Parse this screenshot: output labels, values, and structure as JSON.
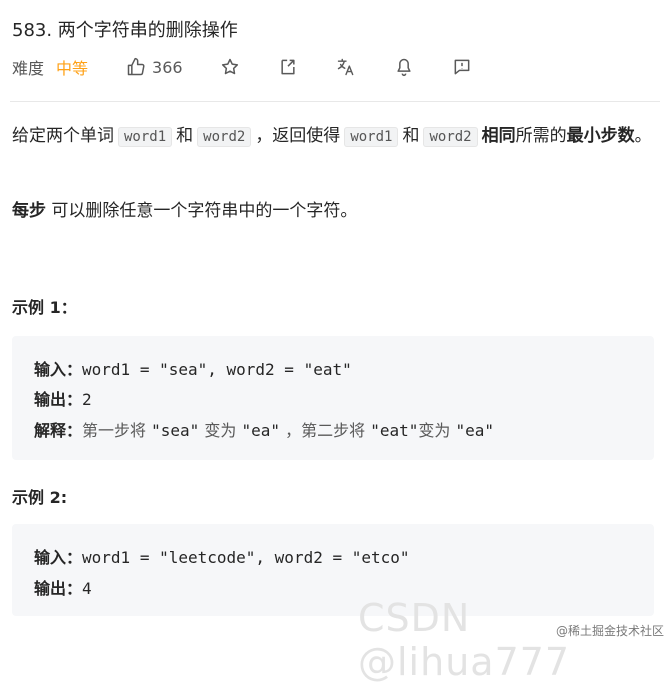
{
  "title": "583. 两个字符串的删除操作",
  "meta": {
    "difficulty_label": "难度",
    "difficulty": "中等",
    "likes": "366"
  },
  "description": {
    "s1": "给定两个单词",
    "code1": "word1",
    "s2": "和",
    "code2": "word2",
    "s3": "，返回使得",
    "code3": "word1",
    "s4": "和",
    "code4": "word2",
    "b1": "相同",
    "s5": "所需的",
    "b2": "最小步数",
    "s6": "。",
    "p2_bold": "每步",
    "p2_text": "可以删除任意一个字符串中的一个字符。"
  },
  "example1": {
    "heading": "示例 1：",
    "input_label": "输入：",
    "input": "word1 = \"sea\", word2 = \"eat\"",
    "output_label": "输出：",
    "output": "2",
    "explain_label": "解释：",
    "e1": "第一步将",
    "e2": "\"sea\"",
    "e3": "变为",
    "e4": "\"ea\"",
    "e5": "，第二步将",
    "e6": "\"eat\"",
    "e7": "变为",
    "e8": "\"ea\""
  },
  "example2": {
    "heading": "示例  2:",
    "input_label": "输入：",
    "input": "word1 = \"leetcode\", word2 = \"etco\"",
    "output_label": "输出：",
    "output": "4"
  },
  "watermark": {
    "main": "CSDN @lihua777",
    "sub": "@稀土掘金技术社区"
  },
  "colors": {
    "difficulty": "#ffa116",
    "code_bg": "#f2f3f4",
    "box_bg": "#f6f7f9"
  }
}
